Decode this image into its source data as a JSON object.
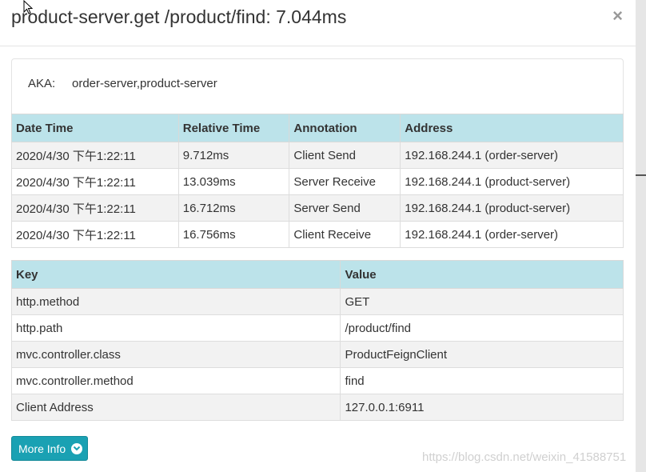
{
  "header": {
    "title": "product-server.get /product/find: 7.044ms",
    "close_label": "×"
  },
  "aka": {
    "label": "AKA:",
    "value": "order-server,product-server"
  },
  "annotations": {
    "columns": [
      "Date Time",
      "Relative Time",
      "Annotation",
      "Address"
    ],
    "rows": [
      [
        "2020/4/30 下午1:22:11",
        "9.712ms",
        "Client Send",
        "192.168.244.1 (order-server)"
      ],
      [
        "2020/4/30 下午1:22:11",
        "13.039ms",
        "Server Receive",
        "192.168.244.1 (product-server)"
      ],
      [
        "2020/4/30 下午1:22:11",
        "16.712ms",
        "Server Send",
        "192.168.244.1 (product-server)"
      ],
      [
        "2020/4/30 下午1:22:11",
        "16.756ms",
        "Client Receive",
        "192.168.244.1 (order-server)"
      ]
    ]
  },
  "tags": {
    "columns": [
      "Key",
      "Value"
    ],
    "rows": [
      [
        "http.method",
        "GET"
      ],
      [
        "http.path",
        "/product/find"
      ],
      [
        "mvc.controller.class",
        "ProductFeignClient"
      ],
      [
        "mvc.controller.method",
        "find"
      ],
      [
        "Client Address",
        "127.0.0.1:6911"
      ]
    ]
  },
  "footer": {
    "more_info_label": "More Info",
    "watermark": "https://blog.csdn.net/weixin_41588751"
  },
  "colors": {
    "header_bg": "#bce3ea",
    "button_bg": "#1aa1b3"
  }
}
